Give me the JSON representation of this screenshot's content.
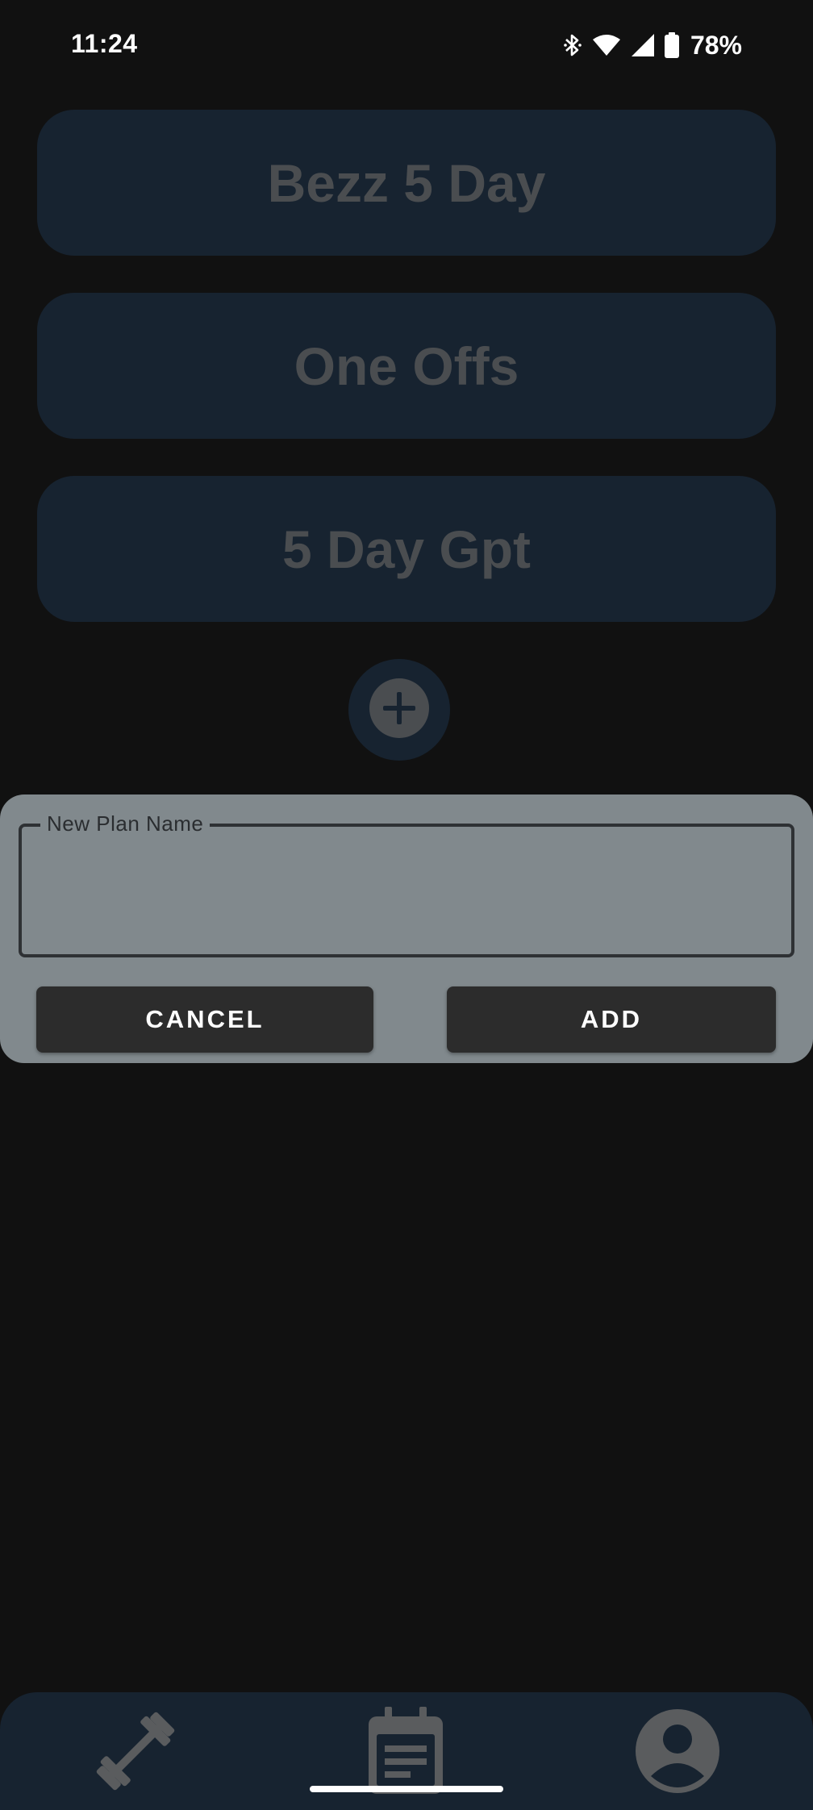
{
  "status_bar": {
    "time": "11:24",
    "battery_percent": "78%",
    "icons": [
      "bluetooth-icon",
      "wifi-icon",
      "signal-icon",
      "battery-icon"
    ]
  },
  "plans": [
    {
      "label": "Bezz 5 Day"
    },
    {
      "label": "One Offs"
    },
    {
      "label": "5 Day Gpt"
    }
  ],
  "add_button": {
    "icon": "plus-circle-icon"
  },
  "dialog": {
    "field_label": "New Plan Name",
    "field_value": "",
    "cancel_label": "CANCEL",
    "add_label": "ADD"
  },
  "bottom_nav": {
    "items": [
      {
        "icon": "dumbbell-icon"
      },
      {
        "icon": "calendar-icon"
      },
      {
        "icon": "account-circle-icon"
      }
    ]
  },
  "colors": {
    "background": "#111111",
    "card": "#172330",
    "card_text": "#4a4d50",
    "dialog": "#81898d",
    "button": "#2c2c2c",
    "nav_icon": "#5a5c5e"
  }
}
